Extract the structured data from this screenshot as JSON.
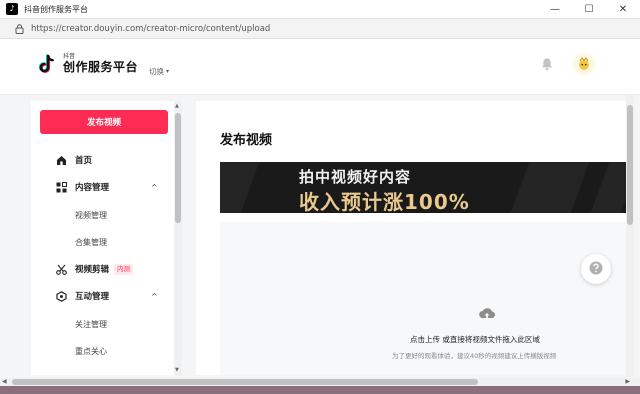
{
  "window": {
    "title": "抖音创作服务平台",
    "minimize_glyph": "—",
    "maximize_glyph": "☐",
    "close_glyph": "✕"
  },
  "browser": {
    "url": "https://creator.douyin.com/creator-micro/content/upload"
  },
  "header": {
    "logo_small": "抖音",
    "logo_main": "创作服务平台",
    "switch_label": "切换",
    "switch_caret": "▾"
  },
  "sidebar": {
    "publish_button": "发布视频",
    "items": [
      {
        "label": "首页",
        "icon": "home-icon"
      },
      {
        "label": "内容管理",
        "icon": "grid-icon",
        "arrow": "^"
      },
      {
        "label": "视频管理"
      },
      {
        "label": "合集管理"
      },
      {
        "label": "视频剪辑",
        "icon": "scissors-icon",
        "badge": "内测"
      },
      {
        "label": "互动管理",
        "icon": "interaction-icon",
        "arrow": "^"
      },
      {
        "label": "关注管理"
      },
      {
        "label": "重点关心"
      }
    ]
  },
  "main": {
    "title": "发布视频",
    "banner": {
      "line1": "拍中视频好内容",
      "line2": "收入预计涨100%"
    },
    "upload": {
      "text": "点击上传 或直接将视频文件拖入此区域",
      "hint": "为了更好的观看体验，建议40秒的视频建议上传横版视频"
    }
  },
  "colors": {
    "accent": "#fe2c55",
    "banner_bg": "#1a1a1a",
    "banner_gold": "#e8c98e"
  }
}
